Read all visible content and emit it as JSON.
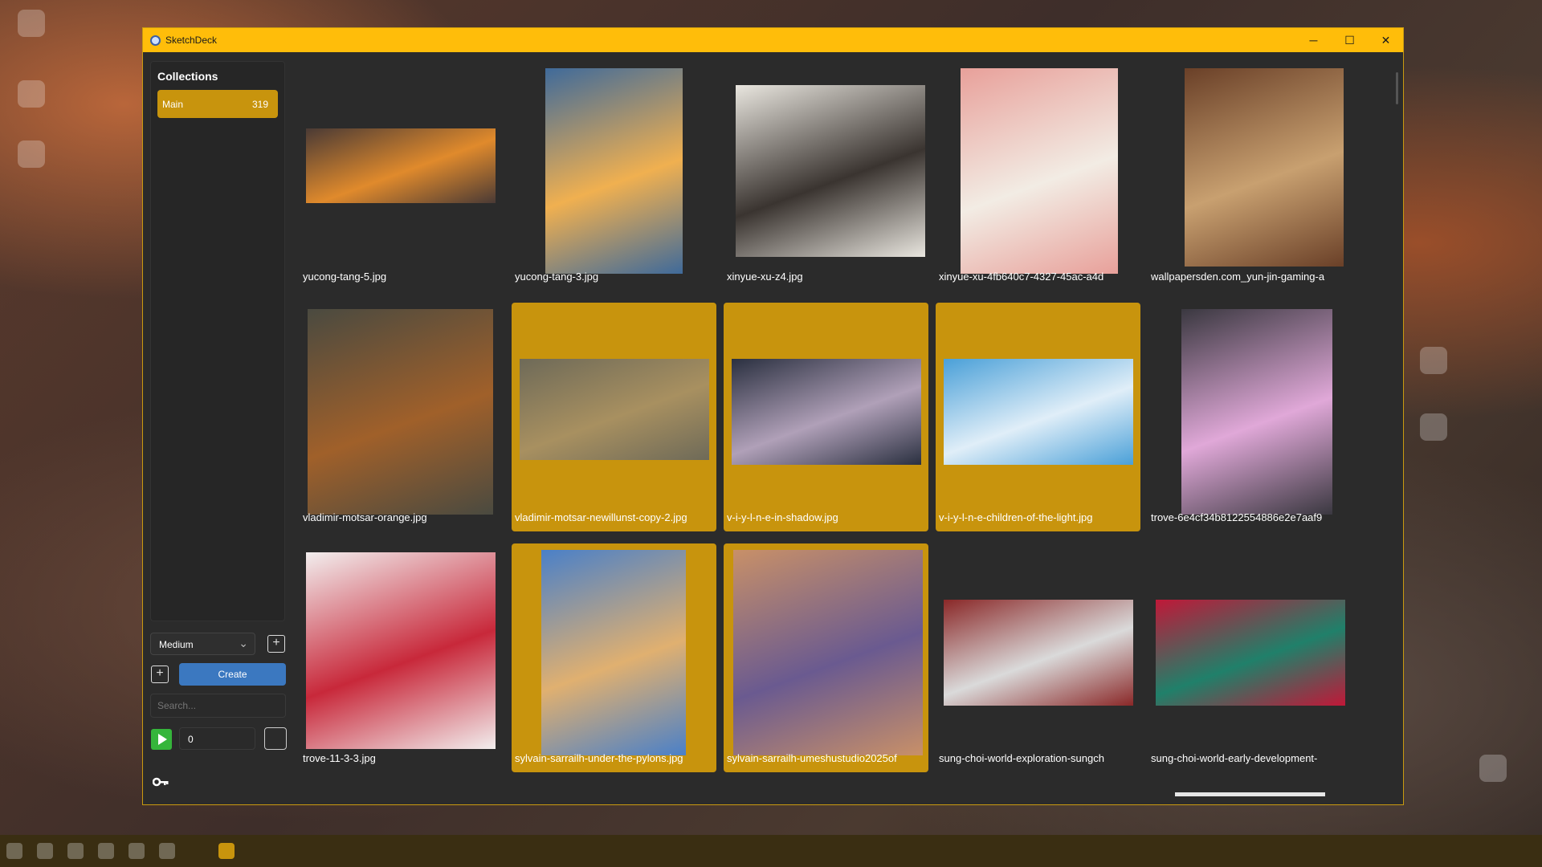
{
  "window": {
    "title": "SketchDeck",
    "accent": "#ffbd0a"
  },
  "titlebar": {
    "minimize": "─",
    "maximize": "☐",
    "close": "✕"
  },
  "sidebar": {
    "heading": "Collections",
    "collections": [
      {
        "name": "Main",
        "count": "319"
      }
    ],
    "size_select": "Medium",
    "create_label": "Create",
    "search_placeholder": "Search...",
    "number_value": "0",
    "key_icon": "key-icon"
  },
  "gallery": [
    {
      "label": "yucong-tang-5.jpg",
      "selected": false,
      "colors": [
        "#4a3a35",
        "#e08a2c"
      ]
    },
    {
      "label": "yucong-tang-3.jpg",
      "selected": false,
      "colors": [
        "#3f6a9a",
        "#f0b050"
      ]
    },
    {
      "label": "xinyue-xu-z4.jpg",
      "selected": false,
      "colors": [
        "#e9e6df",
        "#3a3430"
      ]
    },
    {
      "label": "xinyue-xu-4fb640c7-4327-45ac-a4d",
      "selected": false,
      "colors": [
        "#e8a09a",
        "#f2ece4"
      ]
    },
    {
      "label": "wallpapersden.com_yun-jin-gaming-a",
      "selected": false,
      "colors": [
        "#6a4028",
        "#c8a070"
      ]
    },
    {
      "label": "vladimir-motsar-orange.jpg",
      "selected": false,
      "colors": [
        "#4a4a40",
        "#a0602a"
      ]
    },
    {
      "label": "vladimir-motsar-newillunst-copy-2.jpg",
      "selected": true,
      "colors": [
        "#6e6a58",
        "#a89060"
      ]
    },
    {
      "label": "v-i-y-l-n-e-in-shadow.jpg",
      "selected": true,
      "colors": [
        "#2a3040",
        "#b0a0b8"
      ]
    },
    {
      "label": "v-i-y-l-n-e-children-of-the-light.jpg",
      "selected": true,
      "colors": [
        "#4aa0d8",
        "#e0eef8"
      ]
    },
    {
      "label": "trove-6e4cf34b8122554886e2e7aaf9",
      "selected": false,
      "colors": [
        "#3a3840",
        "#e0a8d8"
      ]
    },
    {
      "label": "trove-11-3-3.jpg",
      "selected": false,
      "colors": [
        "#f2eeee",
        "#c8283a"
      ]
    },
    {
      "label": "sylvain-sarrailh-under-the-pylons.jpg",
      "selected": true,
      "colors": [
        "#4a80c8",
        "#e0b070"
      ]
    },
    {
      "label": "sylvain-sarrailh-umeshustudio2025of",
      "selected": true,
      "colors": [
        "#c89068",
        "#6a5a90"
      ]
    },
    {
      "label": "sung-choi-world-exploration-sungch",
      "selected": false,
      "colors": [
        "#8a2828",
        "#dadada"
      ]
    },
    {
      "label": "sung-choi-world-early-development-",
      "selected": false,
      "colors": [
        "#c01838",
        "#20806a"
      ]
    }
  ]
}
